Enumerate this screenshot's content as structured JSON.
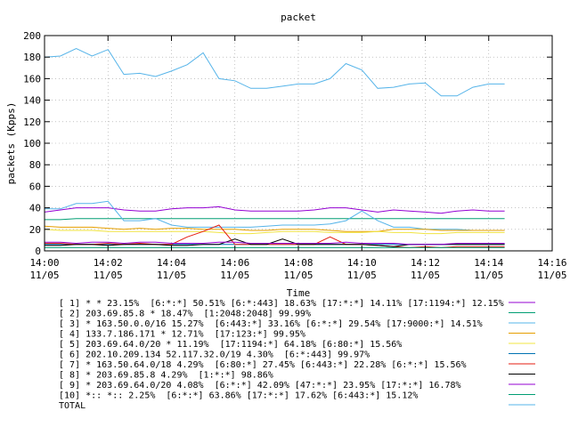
{
  "chart_data": {
    "type": "line",
    "title": "packet",
    "xlabel": "Time",
    "ylabel": "packets (Kpps)",
    "ylim": [
      0,
      200
    ],
    "yticks": [
      0,
      20,
      40,
      60,
      80,
      100,
      120,
      140,
      160,
      180,
      200
    ],
    "xlim": [
      0,
      16
    ],
    "xticks": [
      {
        "x": 0,
        "time": "14:00",
        "date": "11/05"
      },
      {
        "x": 2,
        "time": "14:02",
        "date": "11/05"
      },
      {
        "x": 4,
        "time": "14:04",
        "date": "11/05"
      },
      {
        "x": 6,
        "time": "14:06",
        "date": "11/05"
      },
      {
        "x": 8,
        "time": "14:08",
        "date": "11/05"
      },
      {
        "x": 10,
        "time": "14:10",
        "date": "11/05"
      },
      {
        "x": 12,
        "time": "14:12",
        "date": "11/05"
      },
      {
        "x": 14,
        "time": "14:14",
        "date": "11/05"
      },
      {
        "x": 16,
        "time": "14:16",
        "date": "11/05"
      }
    ],
    "grid": true,
    "x": [
      0,
      0.5,
      1,
      1.5,
      2,
      2.5,
      3,
      3.5,
      4,
      4.5,
      5,
      5.5,
      6,
      6.5,
      7,
      7.5,
      8,
      8.5,
      9,
      9.5,
      10,
      10.5,
      11,
      11.5,
      12,
      12.5,
      13,
      13.5,
      14,
      14.5
    ],
    "series": [
      {
        "name": "[ 1] * * 23.15%  [6:*:*] 50.51% [6:*:443] 18.63% [17:*:*] 14.11% [17:1194:*] 12.15%",
        "color": "#9400d3",
        "values": [
          36,
          38,
          40,
          40,
          40,
          38,
          37,
          37,
          39,
          40,
          40,
          41,
          38,
          37,
          37,
          37,
          37,
          38,
          40,
          40,
          38,
          36,
          38,
          37,
          36,
          35,
          37,
          38,
          37,
          37
        ]
      },
      {
        "name": "[ 2] 203.69.85.8 * 18.47%  [1:2048:2048] 99.99%",
        "color": "#009e73",
        "values": [
          29,
          29,
          30,
          30,
          30,
          30,
          30,
          30,
          30,
          30,
          30,
          30,
          30,
          30,
          30,
          30,
          30,
          30,
          30,
          30,
          30,
          30,
          30,
          30,
          30,
          30,
          30,
          30,
          30,
          30
        ]
      },
      {
        "name": "[ 3] * 163.50.0.0/16 15.27%  [6:443:*] 33.16% [6:*:*] 29.54% [17:9000:*] 14.51%",
        "color": "#56b4e9",
        "values": [
          39,
          39,
          44,
          44,
          46,
          28,
          28,
          30,
          24,
          22,
          22,
          22,
          22,
          22,
          23,
          24,
          24,
          24,
          25,
          28,
          37,
          28,
          22,
          22,
          20,
          20,
          20,
          19,
          19,
          19
        ]
      },
      {
        "name": "[ 4] 133.7.186.171 * 12.71%  [17:123:*] 99.95%",
        "color": "#e69f00",
        "values": [
          23,
          22,
          22,
          22,
          21,
          20,
          21,
          20,
          21,
          21,
          20,
          20,
          20,
          19,
          19,
          20,
          20,
          20,
          19,
          18,
          18,
          18,
          20,
          20,
          20,
          19,
          19,
          19,
          19,
          19
        ]
      },
      {
        "name": "[ 5] 203.69.64.0/20 * 11.19%  [17:1194:*] 64.18% [6:80:*] 15.56%",
        "color": "#f0e442",
        "values": [
          20,
          19,
          19,
          19,
          18,
          18,
          18,
          18,
          18,
          18,
          18,
          17,
          16,
          16,
          17,
          18,
          18,
          18,
          17,
          17,
          17,
          18,
          17,
          17,
          16,
          16,
          17,
          17,
          17,
          17
        ]
      },
      {
        "name": "[ 6] 202.10.209.134 52.117.32.0/19 4.30%  [6:*:443] 99.97%",
        "color": "#0072b2",
        "values": [
          6,
          6,
          6,
          6,
          6,
          6,
          6,
          6,
          6,
          6,
          6,
          6,
          6,
          6,
          6,
          6,
          6,
          6,
          6,
          6,
          6,
          6,
          6,
          6,
          6,
          6,
          6,
          6,
          6,
          6
        ]
      },
      {
        "name": "[ 7] * 163.50.64.0/18 4.29%  [6:80:*] 27.45% [6:443:*] 22.28% [6:*:*] 15.56%",
        "color": "#e51e10",
        "values": [
          7,
          7,
          6,
          6,
          7,
          6,
          7,
          6,
          6,
          13,
          18,
          24,
          6,
          6,
          6,
          6,
          6,
          6,
          13,
          6,
          6,
          5,
          4,
          3,
          4,
          3,
          4,
          4,
          4,
          4
        ]
      },
      {
        "name": "[ 8] * 203.69.85.8 4.29%  [1:*:*] 98.86%",
        "color": "#000000",
        "values": [
          5,
          5,
          6,
          6,
          5,
          6,
          6,
          6,
          5,
          5,
          6,
          6,
          11,
          6,
          6,
          11,
          6,
          6,
          6,
          6,
          6,
          5,
          4,
          6,
          6,
          6,
          6,
          6,
          6,
          6
        ]
      },
      {
        "name": "[ 9] * 203.69.64.0/20 4.08%  [6:*:*] 42.09% [47:*:*] 23.95% [17:*:*] 16.78%",
        "color": "#9400d3",
        "values": [
          8,
          8,
          7,
          8,
          8,
          7,
          8,
          8,
          7,
          7,
          7,
          8,
          8,
          7,
          7,
          7,
          7,
          7,
          7,
          8,
          7,
          7,
          7,
          6,
          6,
          6,
          7,
          7,
          7,
          7
        ]
      },
      {
        "name": "[10] *:: *:: 2.25%  [6:*:*] 63.86% [17:*:*] 17.62% [6:443:*] 15.12%",
        "color": "#009e73",
        "values": [
          3,
          3,
          3,
          3,
          3,
          3,
          3,
          3,
          3,
          3,
          3,
          3,
          3,
          3,
          3,
          3,
          3,
          3,
          3,
          3,
          3,
          3,
          3,
          3,
          3,
          3,
          3,
          3,
          3,
          3
        ]
      },
      {
        "name": "TOTAL",
        "color": "#56b4e9",
        "values": [
          180,
          181,
          188,
          181,
          187,
          164,
          165,
          162,
          167,
          173,
          184,
          160,
          158,
          151,
          151,
          153,
          155,
          155,
          160,
          174,
          168,
          151,
          152,
          155,
          156,
          144,
          144,
          152,
          155,
          155
        ]
      }
    ]
  }
}
